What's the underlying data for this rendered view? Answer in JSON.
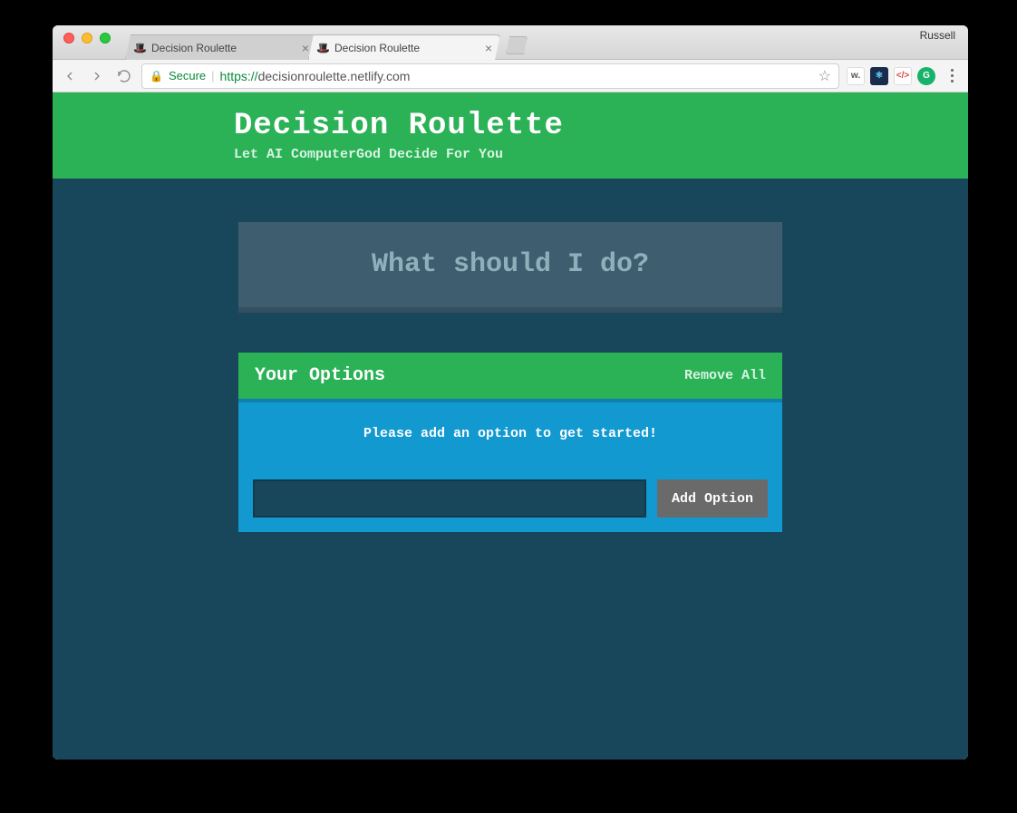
{
  "os": {
    "profile_name": "Russell"
  },
  "browser": {
    "tabs": [
      {
        "title": "Decision Roulette",
        "active": false
      },
      {
        "title": "Decision Roulette",
        "active": true
      }
    ],
    "address": {
      "secure_label": "Secure",
      "protocol": "https://",
      "host_path": "decisionroulette.netlify.com"
    },
    "extensions": [
      {
        "label": "w.",
        "bg": "#ffffff",
        "fg": "#555555"
      },
      {
        "label": "⚛",
        "bg": "#1a2b4c",
        "fg": "#61dafb"
      },
      {
        "label": "</>",
        "bg": "#ffffff",
        "fg": "#d44"
      },
      {
        "label": "G",
        "bg": "#17b36a",
        "fg": "#ffffff"
      }
    ]
  },
  "page": {
    "header": {
      "title": "Decision Roulette",
      "subtitle": "Let AI ComputerGod Decide For You"
    },
    "cta_label": "What should I do?",
    "options": {
      "heading": "Your Options",
      "remove_all_label": "Remove All",
      "empty_message": "Please add an option to get started!",
      "input_value": "",
      "add_button_label": "Add Option"
    }
  }
}
